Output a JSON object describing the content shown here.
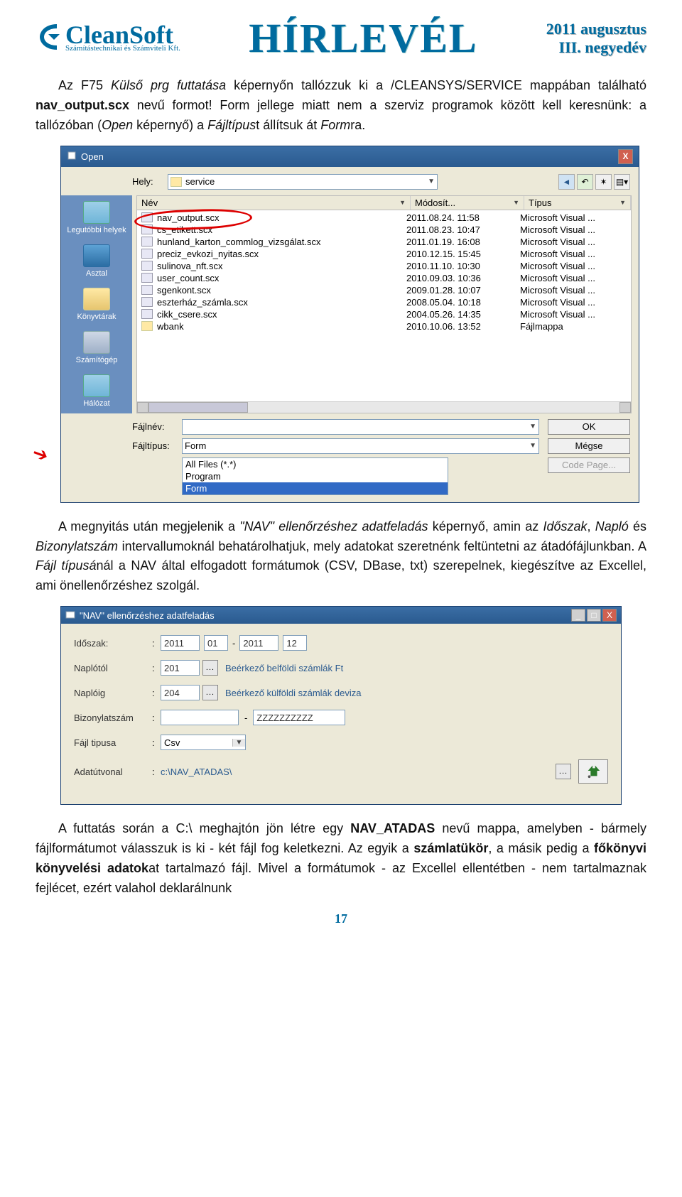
{
  "header": {
    "logo_main": "CleanSoft",
    "logo_sub": "Számítástechnikai és Számviteli Kft.",
    "title": "HÍRLEVÉL",
    "date_line1": "2011 augusztus",
    "date_line2": "III. negyedév"
  },
  "para1": {
    "t1": "Az F75 ",
    "i1": "Külső prg futtatása",
    "t2": " képernyőn tallózzuk ki a /CLEANSYS/SERVICE mappában található ",
    "b1": "nav_output.scx",
    "t3": " nevű formot! Form jellege miatt nem a szerviz programok között kell keresnünk: a tallózóban (",
    "i2": "Open",
    "t4": " képernyő) a ",
    "i3": "Fájltípus",
    "t5": "t állítsuk át ",
    "i4": "Form",
    "t6": "ra."
  },
  "open_dialog": {
    "title": "Open",
    "close_x": "X",
    "location_label": "Hely:",
    "location_value": "service",
    "columns": {
      "name": "Név",
      "date": "Módosít...",
      "type": "Típus"
    },
    "files": [
      {
        "name": "nav_output.scx",
        "date": "2011.08.24. 11:58",
        "type": "Microsoft Visual ...",
        "circled": true
      },
      {
        "name": "cs_etikett.scx",
        "date": "2011.08.23. 10:47",
        "type": "Microsoft Visual ..."
      },
      {
        "name": "hunland_karton_commlog_vizsgálat.scx",
        "date": "2011.01.19. 16:08",
        "type": "Microsoft Visual ..."
      },
      {
        "name": "preciz_evkozi_nyitas.scx",
        "date": "2010.12.15. 15:45",
        "type": "Microsoft Visual ..."
      },
      {
        "name": "sulinova_nft.scx",
        "date": "2010.11.10. 10:30",
        "type": "Microsoft Visual ..."
      },
      {
        "name": "user_count.scx",
        "date": "2010.09.03. 10:36",
        "type": "Microsoft Visual ..."
      },
      {
        "name": "sgenkont.scx",
        "date": "2009.01.28. 10:07",
        "type": "Microsoft Visual ..."
      },
      {
        "name": "eszterház_számla.scx",
        "date": "2008.05.04. 10:18",
        "type": "Microsoft Visual ..."
      },
      {
        "name": "cikk_csere.scx",
        "date": "2004.05.26. 14:35",
        "type": "Microsoft Visual ..."
      },
      {
        "name": "wbank",
        "date": "2010.10.06. 13:52",
        "type": "Fájlmappa",
        "folder": true
      }
    ],
    "filename_label": "Fájlnév:",
    "filename_value": "",
    "filetype_label": "Fájltípus:",
    "filetype_value": "Form",
    "filetype_options": [
      "All Files (*.*)",
      "Program",
      "Form"
    ],
    "ok_label": "OK",
    "cancel_label": "Mégse",
    "codepage_label": "Code Page...",
    "places": {
      "recent": "Legutóbbi helyek",
      "desktop": "Asztal",
      "libs": "Könyvtárak",
      "computer": "Számítógép",
      "network": "Hálózat"
    }
  },
  "para2": {
    "t1": "A megnyitás után megjelenik a ",
    "i1": "\"NAV\" ellenőrzéshez adatfeladás",
    "t2": " képernyő, amin az ",
    "i2": "Időszak",
    "t3": ", ",
    "i3": "Napló",
    "t4": " és ",
    "i4": "Bizonylatszám",
    "t5": " intervallumoknál behatárolhatjuk, mely adatokat szeretnénk feltüntetni az átadófájlunkban. A ",
    "i5": "Fájl típusá",
    "t6": "nál a NAV által elfogadott formátumok (CSV, DBase, txt) szerepelnek, kiegészítve az Excellel, ami önellenőrzéshez szolgál."
  },
  "nav_form": {
    "title": "\"NAV\" ellenőrzéshez adatfeladás",
    "min": "_",
    "max": "□",
    "close": "X",
    "period_label": "Időszak:",
    "period_y1": "2011",
    "period_m1": "01",
    "period_y2": "2011",
    "period_m2": "12",
    "naplo_from_label": "Naplótól",
    "naplo_from_val": "201",
    "naplo_from_desc": "Beérkező belföldi számlák Ft",
    "naplo_to_label": "Naplóig",
    "naplo_to_val": "204",
    "naplo_to_desc": "Beérkező külföldi számlák deviza",
    "biz_label": "Bizonylatszám",
    "biz_from": "",
    "biz_dash": "-",
    "biz_to": "ZZZZZZZZZZ",
    "ftype_label": "Fájl tipusa",
    "ftype_val": "Csv",
    "path_label": "Adatútvonal",
    "path_val": "c:\\NAV_ATADAS\\",
    "colon": ":",
    "ellipsis": "..."
  },
  "para3": {
    "t1": "A futtatás során a C:\\ meghajtón jön létre egy ",
    "b1": "NAV_ATADAS",
    "t2": " nevű mappa, amelyben - bármely fájlformátumot válasszuk is ki - két fájl fog keletkezni. Az egyik a ",
    "b2": "számlatükör",
    "t3": ", a másik pedig a ",
    "b3": "főkönyvi könyvelési adatok",
    "t4": "at tartalmazó fájl. Mivel a formátumok - az Excellel ellentétben - nem tartalmaznak fejlécet, ezért valahol deklarálnunk"
  },
  "page_number": "17"
}
